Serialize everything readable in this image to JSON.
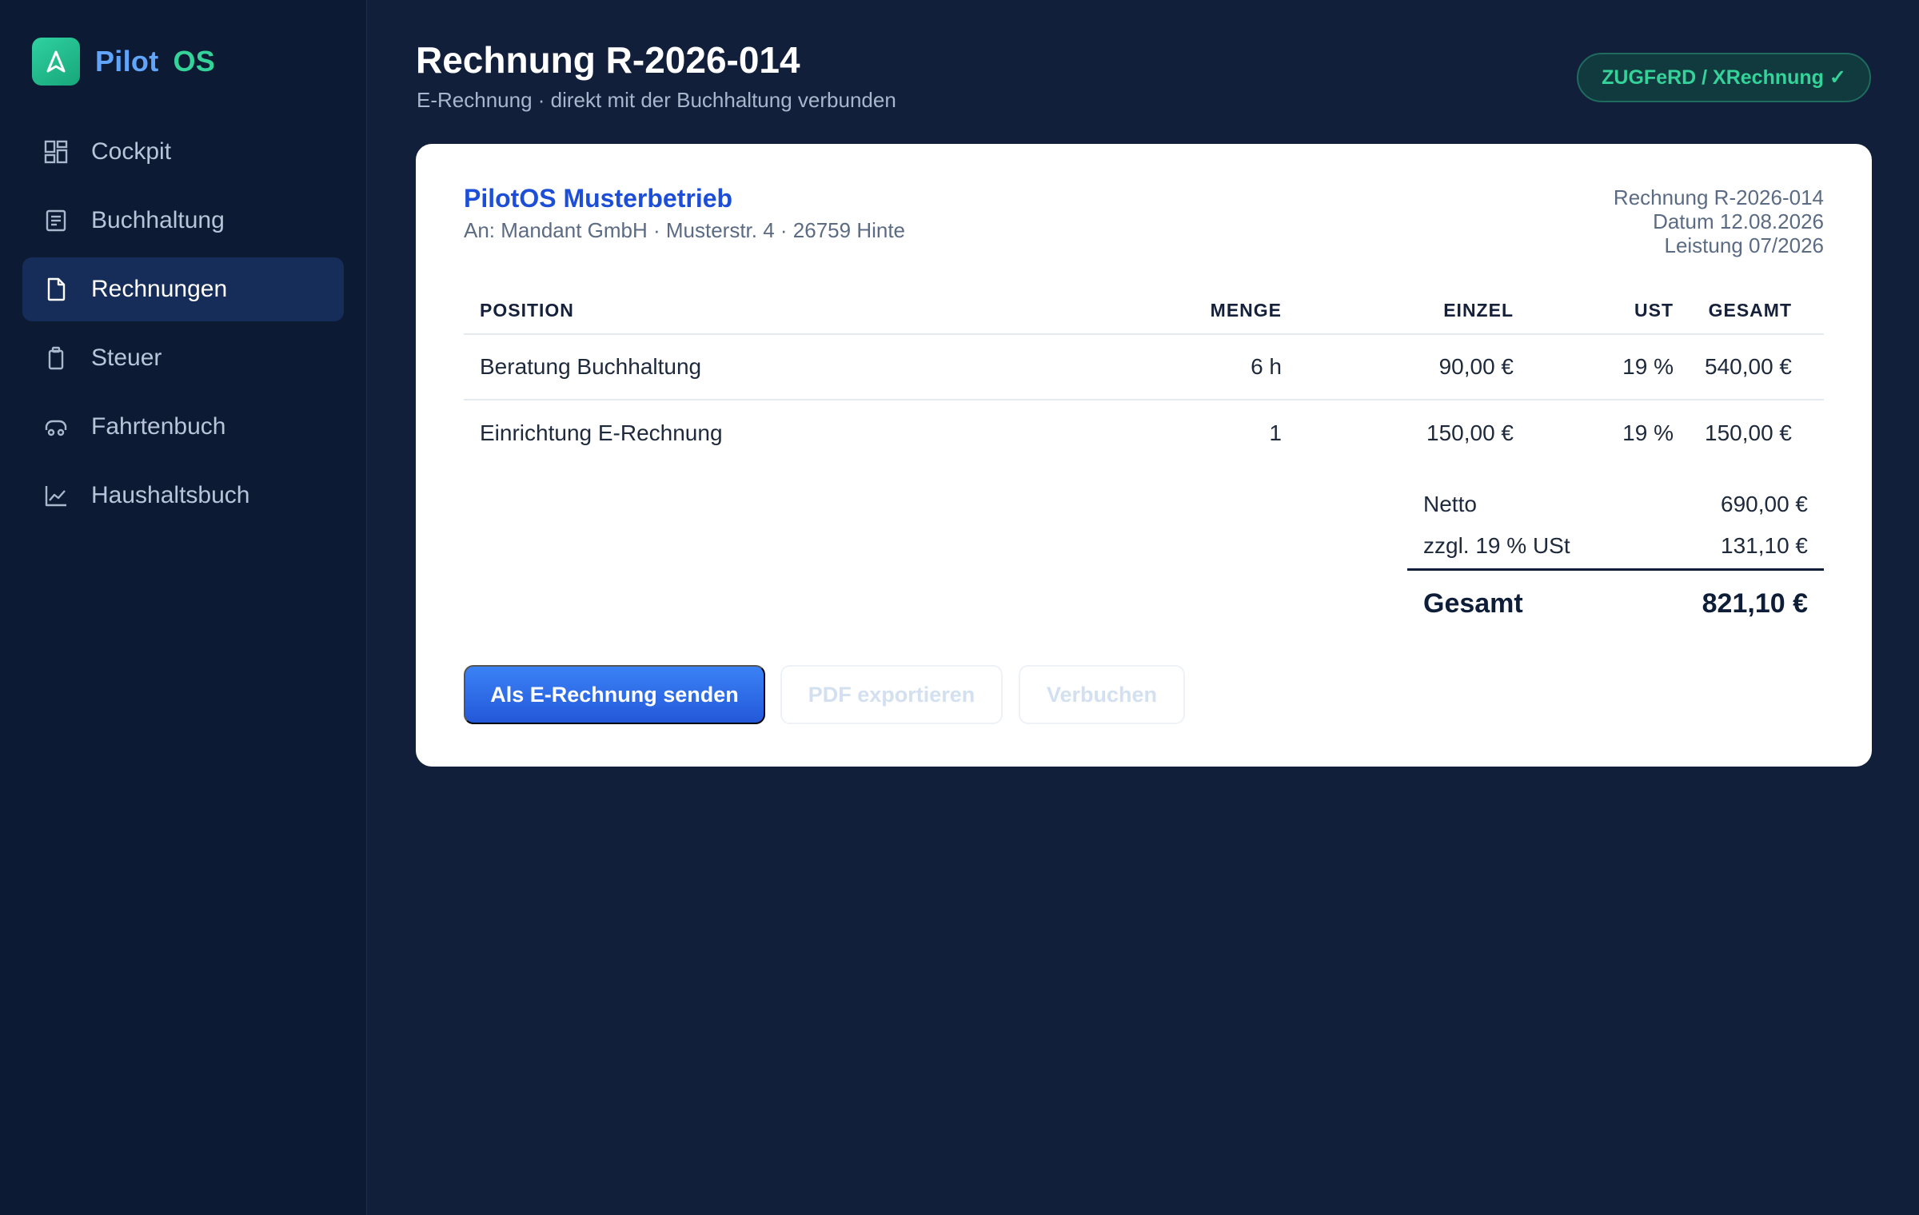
{
  "app": {
    "name_part1": "Pilot",
    "name_part2": "OS"
  },
  "sidebar": {
    "items": [
      {
        "label": "Cockpit",
        "icon": "dashboard-icon",
        "active": false
      },
      {
        "label": "Buchhaltung",
        "icon": "ledger-icon",
        "active": false
      },
      {
        "label": "Rechnungen",
        "icon": "document-icon",
        "active": true
      },
      {
        "label": "Steuer",
        "icon": "clipboard-icon",
        "active": false
      },
      {
        "label": "Fahrtenbuch",
        "icon": "car-icon",
        "active": false
      },
      {
        "label": "Haushaltsbuch",
        "icon": "chart-line-icon",
        "active": false
      }
    ]
  },
  "header": {
    "title": "Rechnung R-2026-014",
    "subtitle": "E-Rechnung · direkt mit der Buchhaltung verbunden",
    "badge": "ZUGFeRD / XRechnung ✓"
  },
  "invoice": {
    "company": "PilotOS Musterbetrieb",
    "recipient": "An: Mandant GmbH · Musterstr. 4 · 26759 Hinte",
    "meta": {
      "number": "Rechnung R-2026-014",
      "date": "Datum 12.08.2026",
      "service": "Leistung 07/2026"
    },
    "columns": {
      "position": "POSITION",
      "quantity": "MENGE",
      "unit_price": "EINZEL",
      "vat": "UST",
      "total": "GESAMT"
    },
    "rows": [
      {
        "position": "Beratung Buchhaltung",
        "quantity": "6 h",
        "unit_price": "90,00 €",
        "vat": "19 %",
        "total": "540,00 €"
      },
      {
        "position": "Einrichtung E-Rechnung",
        "quantity": "1",
        "unit_price": "150,00 €",
        "vat": "19 %",
        "total": "150,00 €"
      }
    ],
    "totals": {
      "net_label": "Netto",
      "net_value": "690,00 €",
      "vat_label": "zzgl. 19 % USt",
      "vat_value": "131,10 €",
      "grand_label": "Gesamt",
      "grand_value": "821,10 €"
    }
  },
  "actions": {
    "send": "Als E-Rechnung senden",
    "export_pdf": "PDF exportieren",
    "book": "Verbuchen"
  },
  "colors": {
    "background": "#111f3a",
    "sidebar": "#0c1a33",
    "accent_blue": "#3b82f6",
    "accent_green": "#34d399",
    "company_blue": "#1d4ed8"
  }
}
